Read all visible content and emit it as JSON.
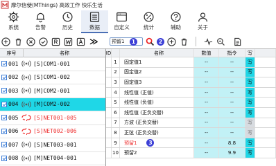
{
  "app": {
    "title": "摩尔信使(MThings) 高效工作 快乐生活"
  },
  "ribbon": [
    {
      "label": "系统",
      "icon": "gear-icon"
    },
    {
      "label": "告警",
      "icon": "bell-icon"
    },
    {
      "label": "历史",
      "icon": "clock-icon"
    },
    {
      "label": "数据",
      "icon": "data-list-icon",
      "active": true
    },
    {
      "label": "自定义",
      "icon": "window-icon"
    },
    {
      "label": "统计",
      "icon": "percent-icon"
    },
    {
      "label": "辅助",
      "icon": "help-icon"
    },
    {
      "label": "关于",
      "icon": "user-icon"
    }
  ],
  "left_toolbar": {
    "more": "≫"
  },
  "left_list": {
    "headers": {
      "seq": "序号",
      "name": "名称"
    },
    "rows": [
      {
        "num": "001",
        "name": "[S]COM1-001",
        "status": "online"
      },
      {
        "num": "002",
        "name": "[S]COM1-002",
        "status": "online"
      },
      {
        "num": "003",
        "name": "[M]COM2-001",
        "status": "online"
      },
      {
        "num": "004",
        "name": "[M]COM2-002",
        "status": "online",
        "selected": true
      },
      {
        "num": "005",
        "name": "[S]NET001-005",
        "status": "offline"
      },
      {
        "num": "006",
        "name": "[S]NET002-006",
        "status": "offline"
      },
      {
        "num": "007",
        "name": "[S]NET003-001",
        "status": "online"
      },
      {
        "num": "008",
        "name": "[M]NET004-001",
        "status": "online"
      }
    ]
  },
  "right_toolbar": {
    "search_value": "预留1",
    "marker1": "1",
    "marker2": "2"
  },
  "table": {
    "headers": {
      "id": "ID",
      "name": "名称",
      "value": "数值",
      "cmd": "指令",
      "write": "写"
    },
    "rows": [
      {
        "no": "1",
        "name": "固定值1",
        "value": "--",
        "cmd": "--",
        "write": "写"
      },
      {
        "no": "2",
        "name": "固定值2",
        "value": "--",
        "cmd": "--",
        "write": "写"
      },
      {
        "no": "3",
        "name": "固定值3",
        "value": "--",
        "cmd": "--",
        "write": "写"
      },
      {
        "no": "4",
        "name": "线性值 (正值)",
        "value": "--",
        "cmd": "--",
        "write": "写"
      },
      {
        "no": "5",
        "name": "线性值 (负值)",
        "value": "--",
        "cmd": "--",
        "write": "写"
      },
      {
        "no": "6",
        "name": "线性值 (正负交替)",
        "value": "--",
        "cmd": "--",
        "write": "写"
      },
      {
        "no": "7",
        "name": "方波 (正负交替)",
        "value": "--",
        "cmd": "--",
        "write": "写"
      },
      {
        "no": "8",
        "name": "正弦 (正负交替)",
        "value": "--",
        "cmd": "--",
        "write": "写"
      },
      {
        "no": "9",
        "name": "预留1",
        "value": "--",
        "cmd": "8.8",
        "write": "写",
        "highlight": true,
        "marker": "3"
      },
      {
        "no": "10",
        "name": "预留2",
        "value": "--",
        "cmd": "9.9",
        "write": "写"
      }
    ]
  },
  "colors": {
    "selected": "#1fd7e7",
    "offline": "#e33333",
    "marker": "#3c3fd6"
  }
}
